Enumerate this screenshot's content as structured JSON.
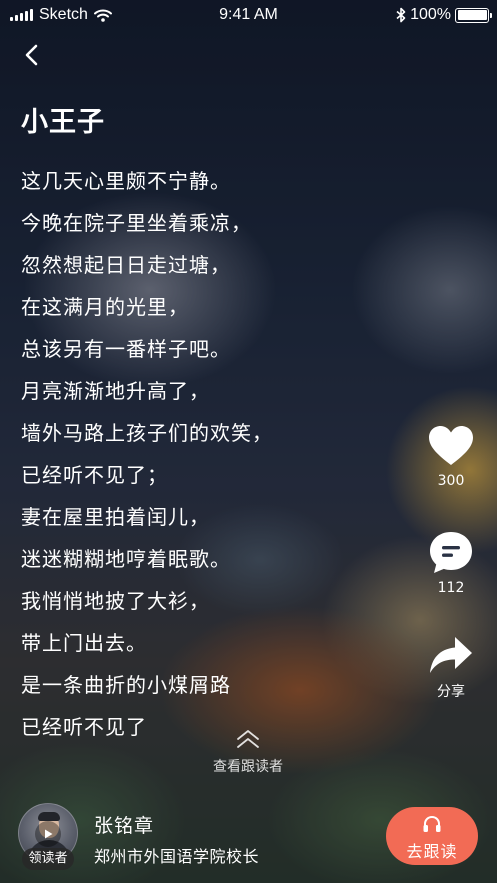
{
  "status_bar": {
    "carrier": "Sketch",
    "time": "9:41 AM",
    "battery": "100%"
  },
  "header": {
    "title": "小王子"
  },
  "poem": {
    "lines": [
      "这几天心里颇不宁静。",
      "今晚在院子里坐着乘凉，",
      "忽然想起日日走过塘，",
      "在这满月的光里，",
      "总该另有一番样子吧。",
      "月亮渐渐地升高了，",
      "墙外马路上孩子们的欢笑，",
      "已经听不见了；",
      "妻在屋里拍着闰儿，",
      "迷迷糊糊地哼着眠歌。",
      "我悄悄地披了大衫，",
      "带上门出去。",
      "是一条曲折的小煤屑路",
      "已经听不见了"
    ]
  },
  "actions": {
    "likes": "300",
    "comments": "112",
    "share_label": "分享"
  },
  "follow_readers": {
    "label": "查看跟读者"
  },
  "reader": {
    "badge": "领读者",
    "name": "张铭章",
    "title": "郑州市外国语学院校长"
  },
  "follow_button": {
    "label": "去跟读"
  },
  "colors": {
    "accent": "#f26b55",
    "text": "#ffffff"
  },
  "icons": {
    "back": "chevron-left-icon",
    "like": "heart-icon",
    "comment": "comment-bubble-icon",
    "share": "share-arrow-icon",
    "expand": "double-chevron-up-icon",
    "play": "play-icon",
    "follow": "headphones-icon"
  }
}
